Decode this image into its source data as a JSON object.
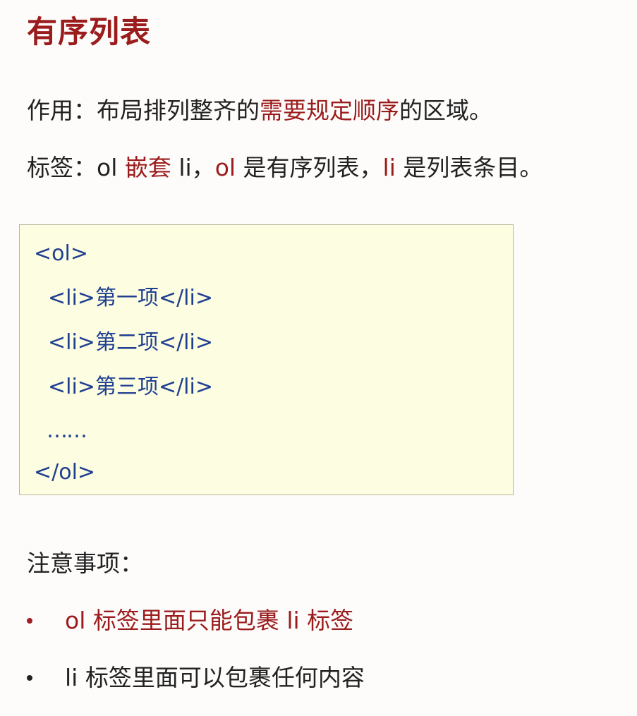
{
  "title": "有序列表",
  "purpose": {
    "label": "作用：",
    "text_before": "布局排列整齐的",
    "highlight": "需要规定顺序",
    "text_after": "的区域。"
  },
  "tag_line": {
    "label": "标签：",
    "part1": "ol ",
    "part2": "嵌套",
    "part3": " li，",
    "part4": "ol",
    "part5": " 是有序列表，",
    "part6": "li",
    "part7": " 是列表条目。"
  },
  "code": {
    "lines": [
      "<ol>",
      "<li>第一项</li>",
      "<li>第二项</li>",
      "<li>第三项</li>",
      "……",
      "</ol>"
    ]
  },
  "notes": {
    "heading": "注意事项：",
    "items": [
      "ol 标签里面只能包裹 li 标签",
      "li 标签里面可以包裹任何内容"
    ]
  },
  "colors": {
    "accent_red": "#9b1c1c",
    "code_blue": "#1f3f91",
    "code_bg": "#fdfde1"
  }
}
